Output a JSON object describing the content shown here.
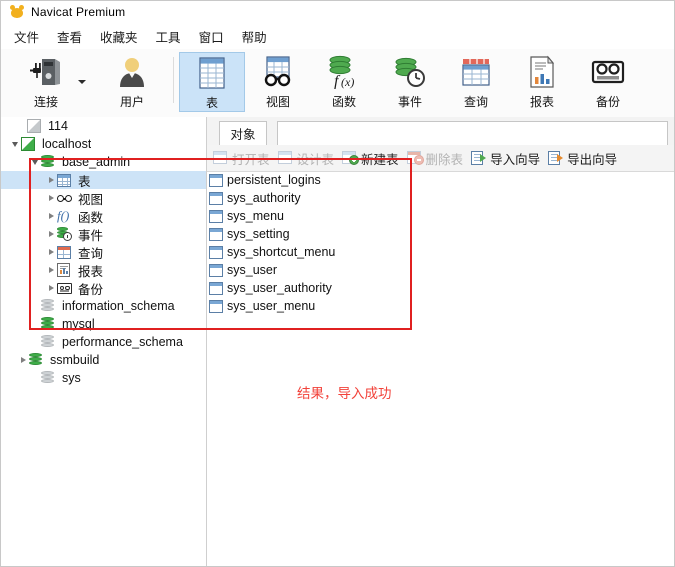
{
  "window": {
    "title": "Navicat Premium",
    "app_icon": "navicat-logo-icon"
  },
  "menubar": {
    "items": [
      {
        "label": "文件",
        "name": "menu-file"
      },
      {
        "label": "查看",
        "name": "menu-view"
      },
      {
        "label": "收藏夹",
        "name": "menu-favorites"
      },
      {
        "label": "工具",
        "name": "menu-tools"
      },
      {
        "label": "窗口",
        "name": "menu-window"
      },
      {
        "label": "帮助",
        "name": "menu-help"
      }
    ]
  },
  "toolbar": {
    "buttons": [
      {
        "label": "连接",
        "icon": "connection-icon",
        "active": false
      },
      {
        "label": "用户",
        "icon": "user-icon",
        "active": false
      },
      {
        "label": "表",
        "icon": "table-icon",
        "active": true
      },
      {
        "label": "视图",
        "icon": "view-glasses-icon",
        "active": false
      },
      {
        "label": "函数",
        "icon": "function-fx-icon",
        "active": false
      },
      {
        "label": "事件",
        "icon": "event-clock-icon",
        "active": false
      },
      {
        "label": "查询",
        "icon": "query-grid-icon",
        "active": false
      },
      {
        "label": "报表",
        "icon": "report-icon",
        "active": false
      },
      {
        "label": "备份",
        "icon": "backup-cassette-icon",
        "active": false
      }
    ],
    "dropdown_caret": "chevron-down-icon"
  },
  "sidebar": {
    "nodes": [
      {
        "label": "114",
        "indent": 1,
        "icon": "connection-offline-icon",
        "chevron": "none",
        "selected": false
      },
      {
        "label": "localhost",
        "indent": 1,
        "icon": "connection-online-icon",
        "chevron": "down",
        "selected": false
      },
      {
        "label": "base_admin",
        "indent": 2,
        "icon": "database-icon",
        "chevron": "down",
        "selected": false
      },
      {
        "label": "表",
        "indent": 3,
        "icon": "table-grid-icon",
        "chevron": "right",
        "selected": true
      },
      {
        "label": "视图",
        "indent": 3,
        "icon": "view-glasses-icon",
        "chevron": "right",
        "selected": false
      },
      {
        "label": "函数",
        "indent": 3,
        "icon": "function-fx-icon",
        "chevron": "right",
        "selected": false
      },
      {
        "label": "事件",
        "indent": 3,
        "icon": "event-clock-icon",
        "chevron": "right",
        "selected": false
      },
      {
        "label": "查询",
        "indent": 3,
        "icon": "query-grid-icon",
        "chevron": "right",
        "selected": false
      },
      {
        "label": "报表",
        "indent": 3,
        "icon": "report-icon",
        "chevron": "right",
        "selected": false
      },
      {
        "label": "备份",
        "indent": 3,
        "icon": "backup-cassette-icon",
        "chevron": "right",
        "selected": false
      },
      {
        "label": "information_schema",
        "indent": 2,
        "icon": "database-grey-icon",
        "chevron": "none",
        "selected": false
      },
      {
        "label": "mysql",
        "indent": 2,
        "icon": "database-icon",
        "chevron": "none",
        "selected": false
      },
      {
        "label": "performance_schema",
        "indent": 2,
        "icon": "database-grey-icon",
        "chevron": "none",
        "selected": false
      },
      {
        "label": "ssmbuild",
        "indent": 2,
        "icon": "database-icon",
        "chevron": "right",
        "selected": false
      },
      {
        "label": "sys",
        "indent": 2,
        "icon": "database-grey-icon",
        "chevron": "none",
        "selected": false
      }
    ]
  },
  "content": {
    "tab": {
      "label": "对象"
    },
    "object_toolbar": [
      {
        "label": "打开表",
        "icon": "open-table-icon",
        "disabled": true
      },
      {
        "label": "设计表",
        "icon": "design-table-icon",
        "disabled": true
      },
      {
        "label": "新建表",
        "icon": "new-table-icon",
        "disabled": false
      },
      {
        "label": "删除表",
        "icon": "delete-table-icon",
        "disabled": true
      },
      {
        "label": "导入向导",
        "icon": "import-wizard-icon",
        "disabled": false
      },
      {
        "label": "导出向导",
        "icon": "export-wizard-icon",
        "disabled": false
      }
    ],
    "tables": [
      "persistent_logins",
      "sys_authority",
      "sys_menu",
      "sys_setting",
      "sys_shortcut_menu",
      "sys_user",
      "sys_user_authority",
      "sys_user_menu"
    ]
  },
  "annotations": {
    "rect_color": "#e02020",
    "note": "结果，导入成功",
    "note_color": "#f2423a"
  }
}
